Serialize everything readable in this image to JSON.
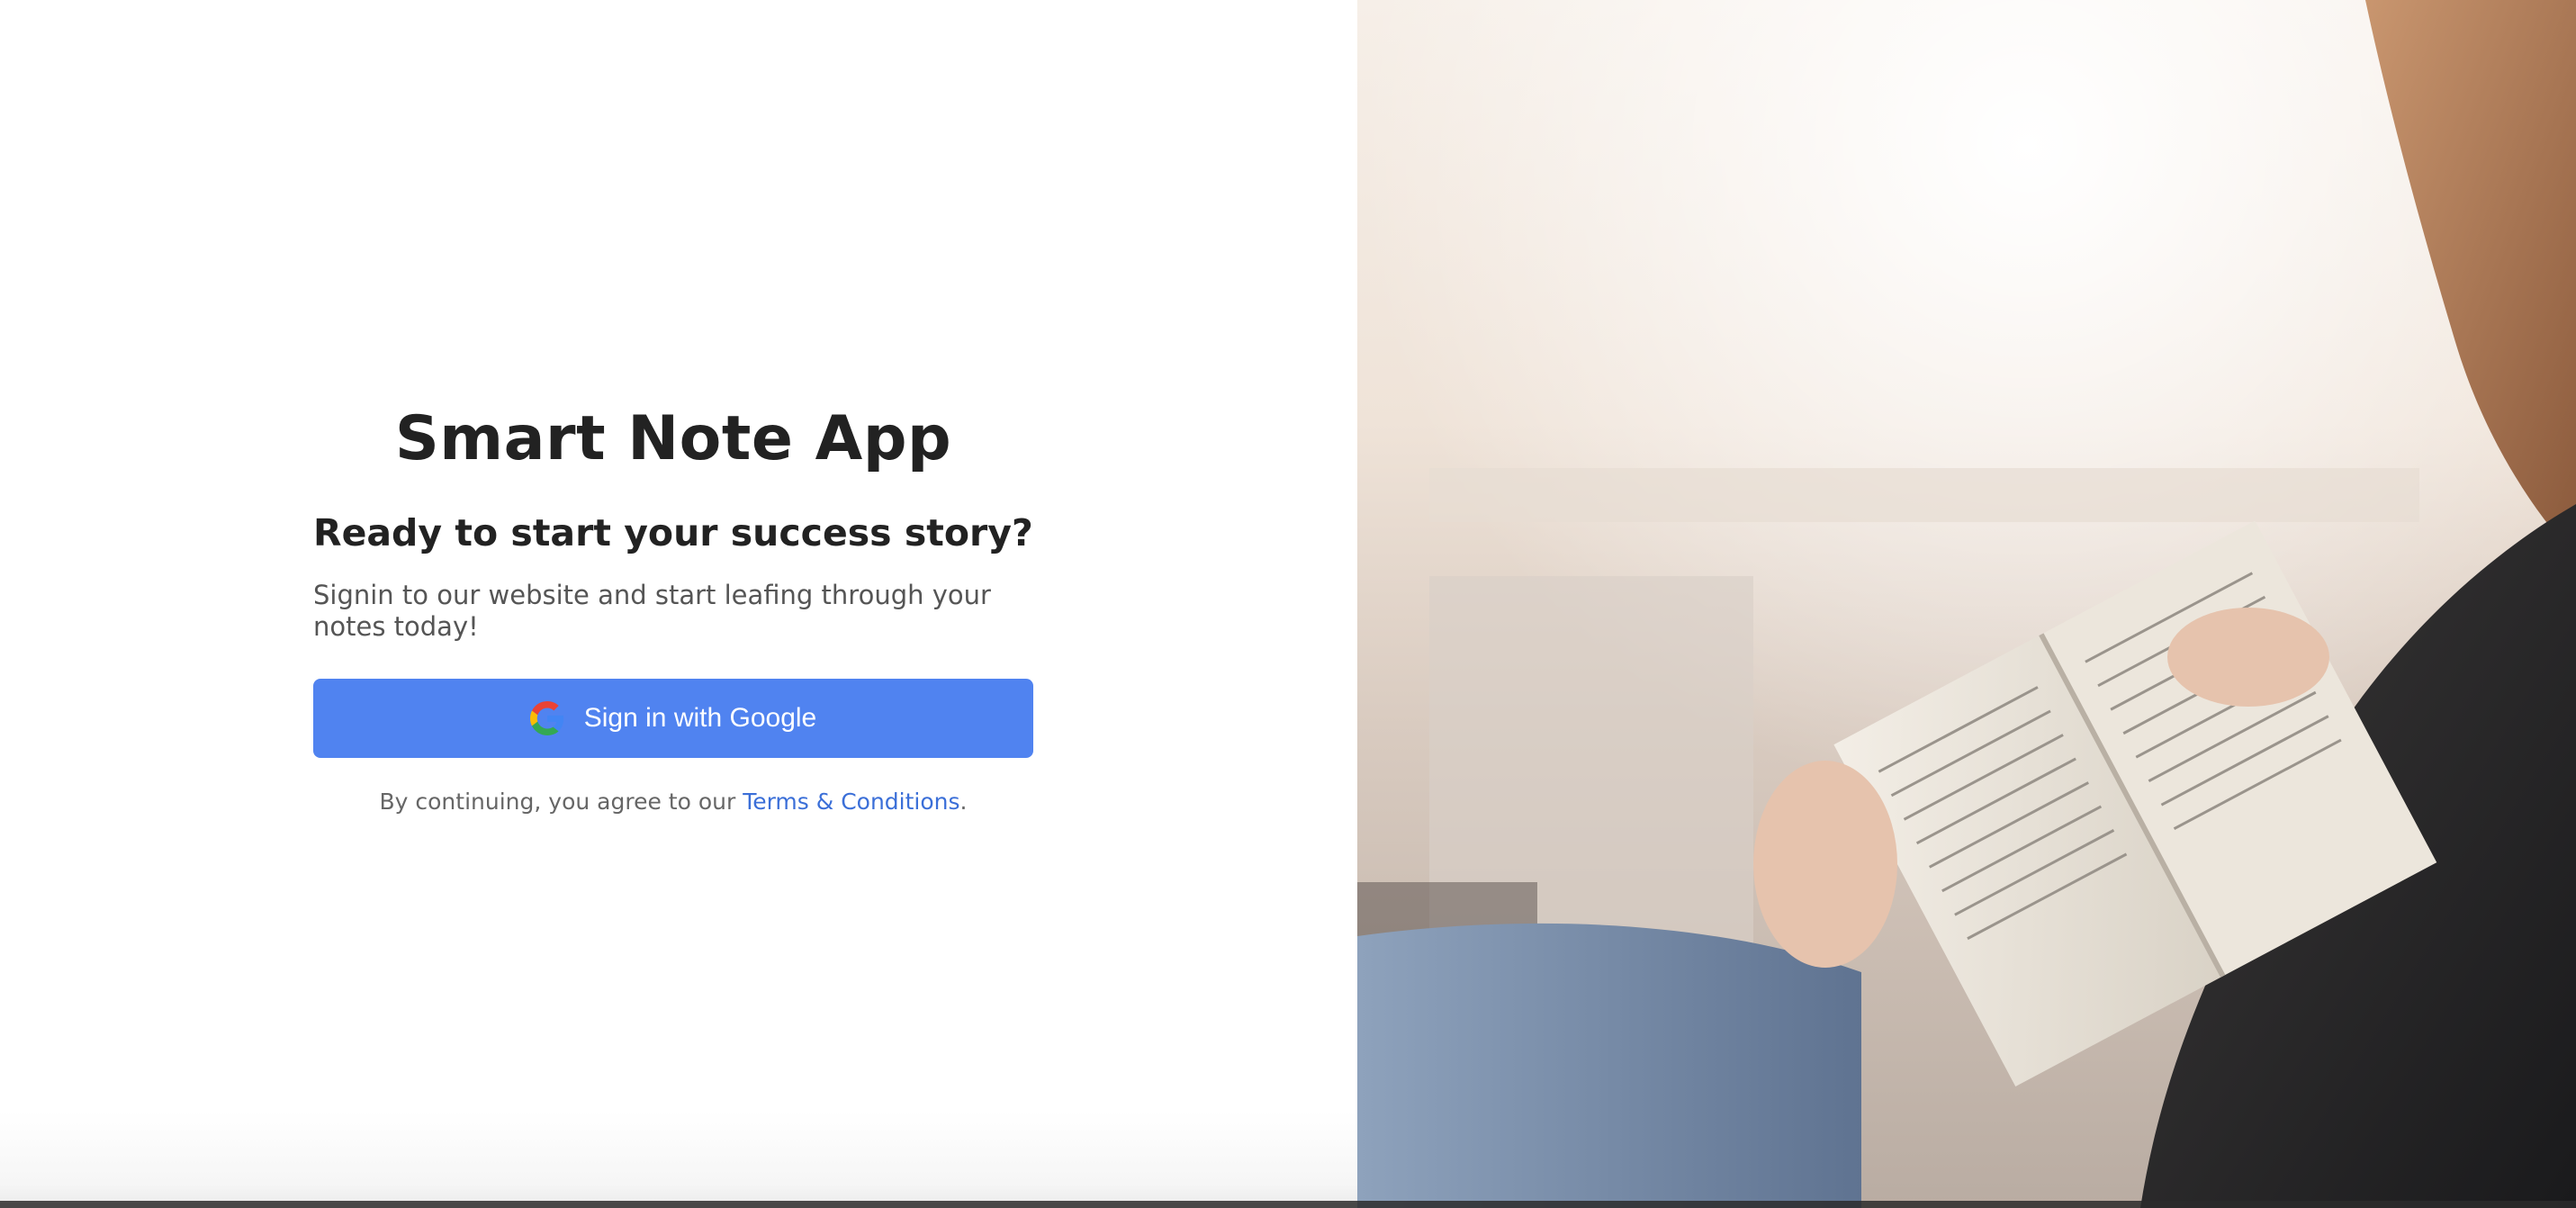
{
  "login": {
    "app_title": "Smart Note App",
    "subtitle": "Ready to start your success story?",
    "description": "Signin to our website and start leafing through your notes today!",
    "google_button_label": "Sign in with Google",
    "terms_prefix": "By continuing, you agree to our ",
    "terms_link_label": "Terms & Conditions",
    "terms_suffix": "."
  },
  "icons": {
    "google": "google-g-icon"
  },
  "colors": {
    "primary_button": "#5083f0",
    "link": "#3b6fd8",
    "heading_text": "#222222",
    "body_text": "#555555"
  }
}
